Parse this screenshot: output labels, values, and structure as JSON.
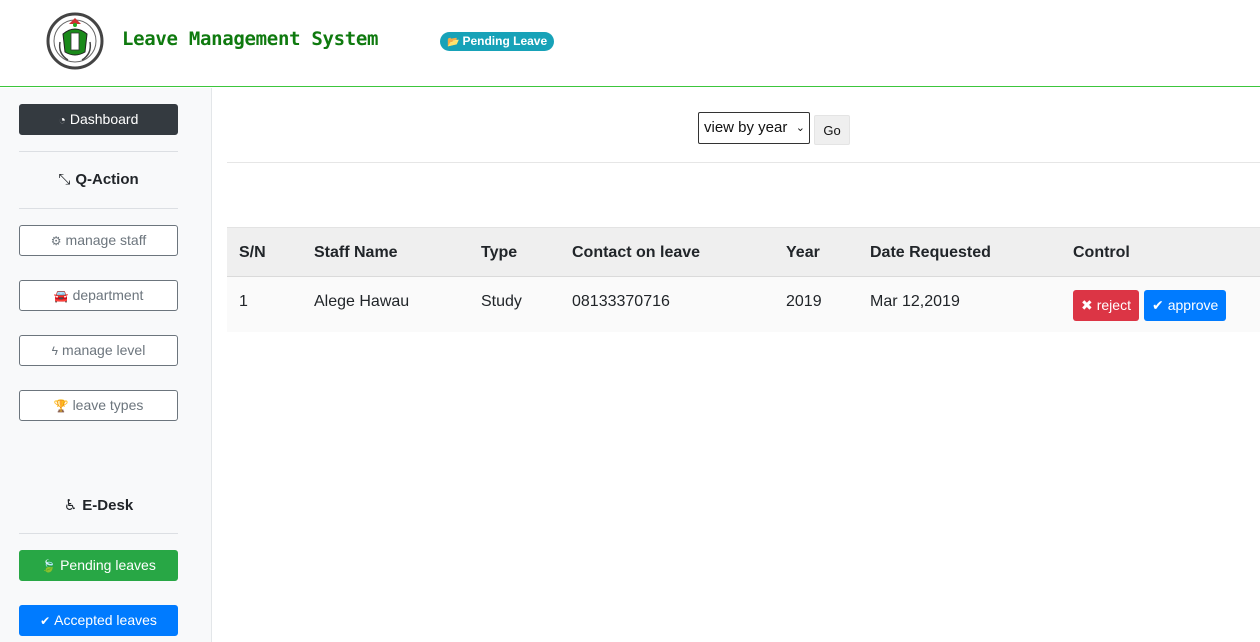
{
  "header": {
    "title": "Leave Management System",
    "badge": "Pending Leave",
    "badge_icon": "folder-open-icon"
  },
  "sidebar": {
    "dashboard": "Dashboard",
    "qaction_title": "Q-Action",
    "qaction_items": [
      "manage staff",
      "department",
      "manage level",
      "leave types"
    ],
    "edesk_title": "E-Desk",
    "edesk_items": [
      "Pending leaves",
      "Accepted leaves"
    ]
  },
  "filter": {
    "selected": "view by year",
    "go": "Go"
  },
  "table": {
    "headers": [
      "S/N",
      "Staff Name",
      "Type",
      "Contact on leave",
      "Year",
      "Date Requested",
      "Control"
    ],
    "rows": [
      [
        "1",
        "Alege Hawau",
        "Study",
        "08133370716",
        "2019",
        "Mar 12,2019"
      ]
    ],
    "reject_label": "reject",
    "approve_label": "approve"
  },
  "colors": {
    "title_green": "#0f7a0f",
    "header_border": "#3cc63c",
    "badge": "#17a2b8",
    "danger": "#dc3545",
    "primary": "#007bff",
    "success": "#28a745",
    "dark": "#343a40"
  }
}
